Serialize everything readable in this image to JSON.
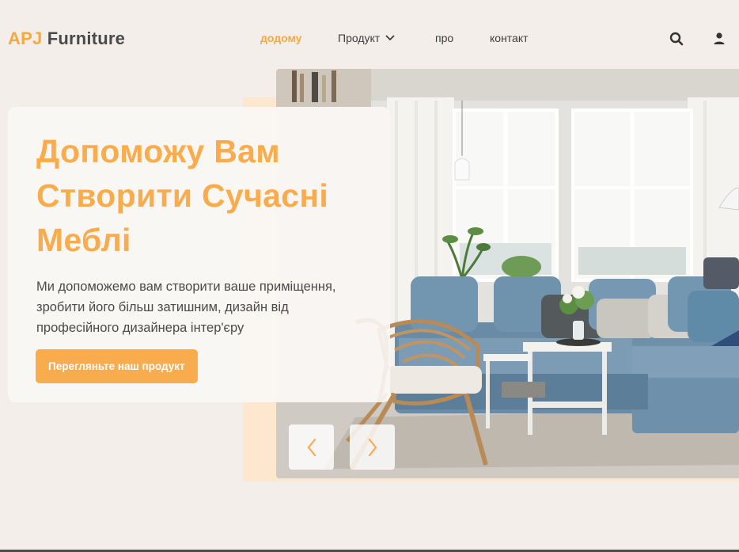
{
  "logo": {
    "brand": "APJ",
    "rest": " Furniture"
  },
  "nav": {
    "home": "додому",
    "product": "Продукт",
    "about": "про",
    "contact": "контакт"
  },
  "header_icons": {
    "search": "search-icon",
    "user": "user-icon"
  },
  "hero": {
    "title": "Допоможу Вам Створити Сучасні Меблі",
    "description": "Ми допоможемо вам створити ваше приміщення, зробити його більш затишним, дизайн від професійного дизайнера інтер'єру",
    "cta_label": "Перегляньте наш продукт",
    "image_subject": "living room with blue sectional sofa, rattan chair and white side table",
    "controls": {
      "prev": "chevron-left-icon",
      "next": "chevron-right-icon"
    }
  },
  "colors": {
    "accent": "#f9ac4e",
    "background": "#f3eeea",
    "peach": "#fde8cf",
    "text": "#3d3d3d"
  }
}
